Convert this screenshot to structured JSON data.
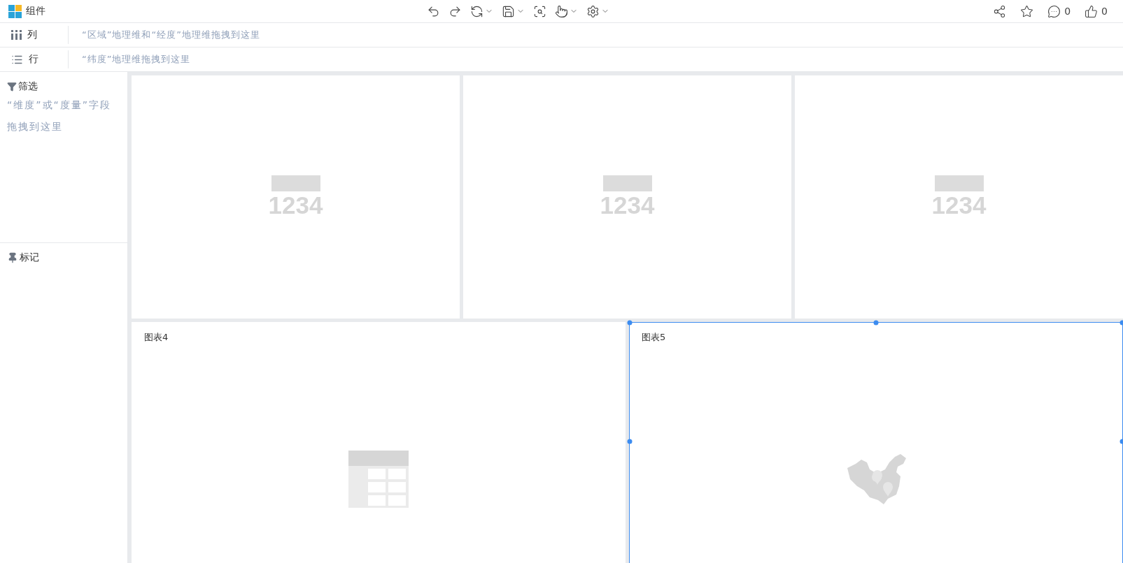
{
  "app": {
    "title": "组件"
  },
  "toolbar": [
    {
      "kind": "undo",
      "dropdown": false
    },
    {
      "kind": "redo",
      "dropdown": false
    },
    {
      "kind": "refresh",
      "dropdown": true
    },
    {
      "kind": "save",
      "dropdown": true
    },
    {
      "kind": "preview",
      "dropdown": false
    },
    {
      "kind": "interact",
      "dropdown": true
    },
    {
      "kind": "settings",
      "dropdown": true
    }
  ],
  "actions": [
    {
      "kind": "share"
    },
    {
      "kind": "favorite"
    },
    {
      "kind": "comment",
      "count": "0"
    },
    {
      "kind": "like",
      "count": "0"
    }
  ],
  "shelves": [
    {
      "kind": "columns",
      "label": "列",
      "placeholder": "“区域”地理维和“经度”地理维拖拽到这里"
    },
    {
      "kind": "rows",
      "label": "行",
      "placeholder": "“纬度”地理维拖拽到这里"
    }
  ],
  "filter": {
    "title": "筛选",
    "hint": "“维度”或“度量”字段拖拽到这里"
  },
  "marks": {
    "title": "标记"
  },
  "widgets": [
    [
      {
        "kind": "kpi",
        "number": "1234",
        "selected": false
      },
      {
        "kind": "kpi",
        "number": "1234",
        "selected": false
      },
      {
        "kind": "kpi",
        "number": "1234",
        "selected": false
      }
    ],
    [
      {
        "kind": "table",
        "title": "图表4",
        "selected": false
      },
      {
        "kind": "map",
        "title": "图表5",
        "selected": true
      }
    ]
  ]
}
